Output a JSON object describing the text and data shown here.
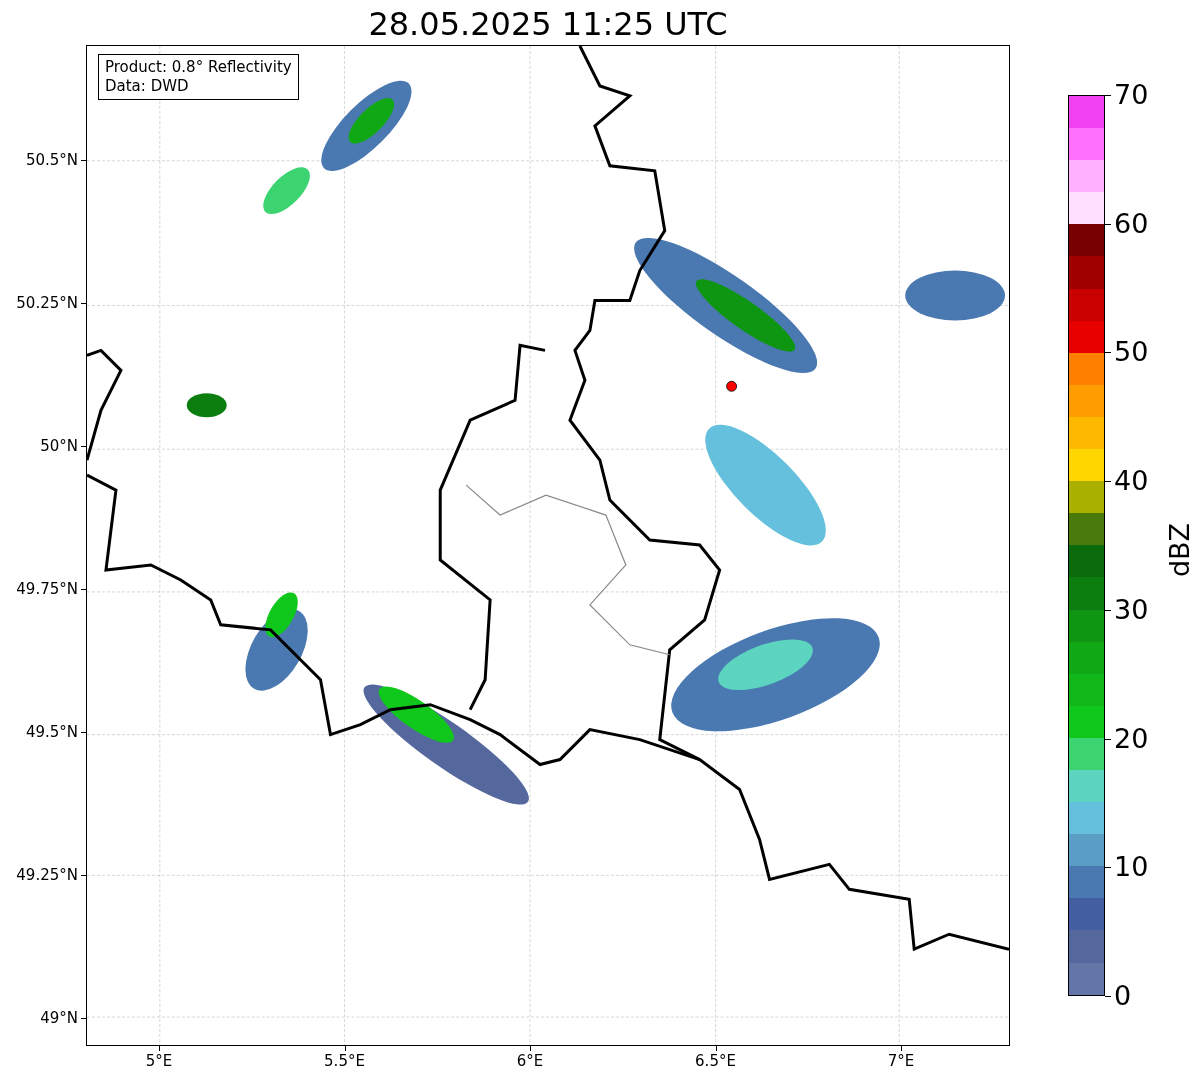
{
  "title": "28.05.2025 11:25 UTC",
  "legend": [
    "Product: 0.8° Reflectivity",
    "Data: DWD"
  ],
  "y_ticks": [
    "50.5°N",
    "50.25°N",
    "50°N",
    "49.75°N",
    "49.5°N",
    "49.25°N",
    "49°N"
  ],
  "x_ticks": [
    "5°E",
    "5.5°E",
    "6°E",
    "6.5°E",
    "7°E"
  ],
  "colorbar": {
    "label": "dBZ",
    "ticks": [
      "70",
      "60",
      "50",
      "40",
      "30",
      "20",
      "10",
      "0"
    ],
    "bands": [
      {
        "color": "#f040f0"
      },
      {
        "color": "#ff70ff"
      },
      {
        "color": "#ffb0ff"
      },
      {
        "color": "#ffe0ff"
      },
      {
        "color": "#780000"
      },
      {
        "color": "#a00000"
      },
      {
        "color": "#c80000"
      },
      {
        "color": "#e80000"
      },
      {
        "color": "#ff8000"
      },
      {
        "color": "#ff9c00"
      },
      {
        "color": "#ffb800"
      },
      {
        "color": "#ffd600"
      },
      {
        "color": "#aab000"
      },
      {
        "color": "#4a7a0c"
      },
      {
        "color": "#0a6a0c"
      },
      {
        "color": "#0c7e10"
      },
      {
        "color": "#0e9612"
      },
      {
        "color": "#10a814"
      },
      {
        "color": "#12b81a"
      },
      {
        "color": "#10c81c"
      },
      {
        "color": "#3cd470"
      },
      {
        "color": "#5cd4c0"
      },
      {
        "color": "#64c0dc"
      },
      {
        "color": "#5a9ec6"
      },
      {
        "color": "#4a78b0"
      },
      {
        "color": "#445ea2"
      },
      {
        "color": "#54689e"
      },
      {
        "color": "#6475a8"
      }
    ]
  }
}
